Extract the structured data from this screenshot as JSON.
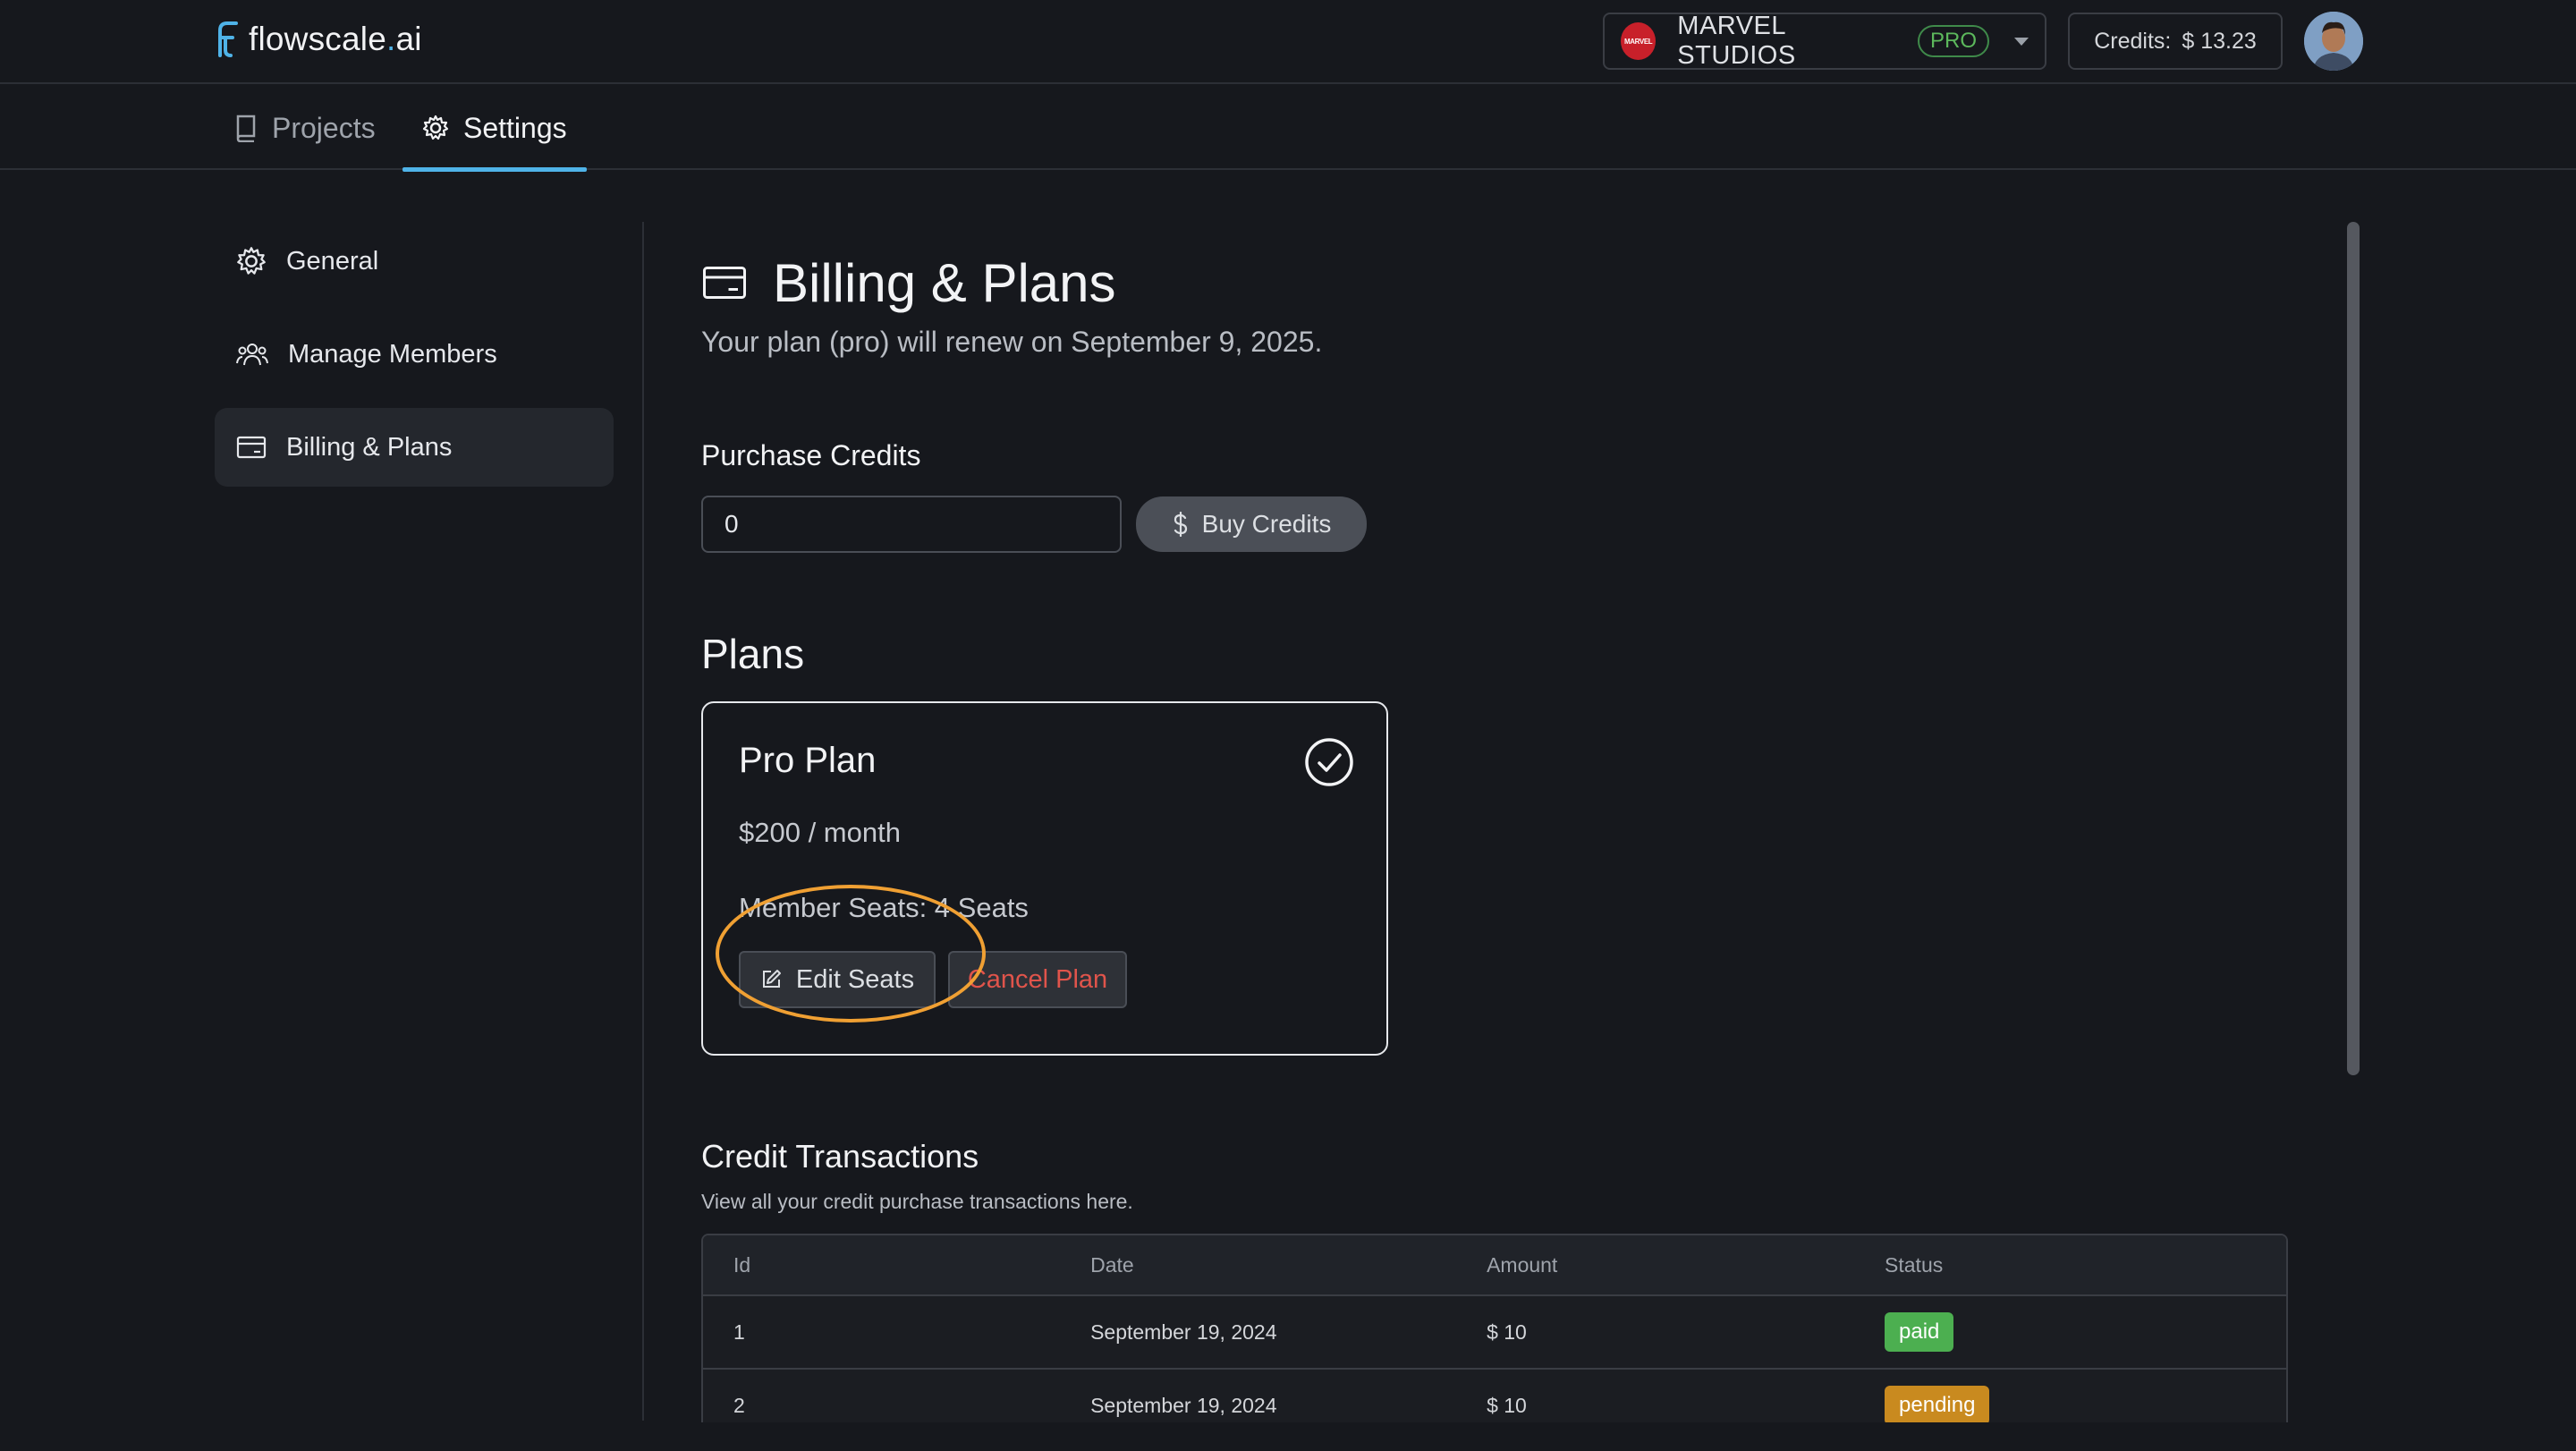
{
  "app": {
    "logo_text": "flowscale",
    "logo_dot": ".",
    "logo_suffix": "ai"
  },
  "header": {
    "org_avatar_text": "MARVEL",
    "org_name": "MARVEL STUDIOS",
    "plan_badge": "PRO",
    "credits_label": "Credits:",
    "credits_value": "$ 13.23"
  },
  "tabs": [
    {
      "label": "Projects",
      "icon": "book-icon"
    },
    {
      "label": "Settings",
      "icon": "gear-icon",
      "active": true
    }
  ],
  "sidebar": {
    "items": [
      {
        "label": "General",
        "icon": "gear-icon"
      },
      {
        "label": "Manage Members",
        "icon": "users-icon"
      },
      {
        "label": "Billing & Plans",
        "icon": "credit-card-icon",
        "active": true
      }
    ]
  },
  "main": {
    "title": "Billing & Plans",
    "subtitle": "Your plan (pro) will renew on September 9, 2025.",
    "purchase": {
      "label": "Purchase Credits",
      "input_value": "0",
      "buy_label": "Buy Credits"
    },
    "plans": {
      "title": "Plans",
      "card": {
        "name": "Pro Plan",
        "price": "$200 / month",
        "seats": "Member Seats: 4 Seats",
        "edit_label": "Edit Seats",
        "cancel_label": "Cancel Plan"
      }
    },
    "transactions": {
      "title": "Credit Transactions",
      "subtitle": "View all your credit purchase transactions here.",
      "columns": [
        "Id",
        "Date",
        "Amount",
        "Status"
      ],
      "rows": [
        {
          "id": "1",
          "date": "September 19, 2024",
          "amount": "$ 10",
          "status": "paid"
        },
        {
          "id": "2",
          "date": "September 19, 2024",
          "amount": "$ 10",
          "status": "pending"
        }
      ]
    }
  },
  "colors": {
    "background": "#16181d",
    "accent": "#4fb3e8",
    "paid": "#4caf50",
    "pending": "#c98a1f",
    "danger": "#e0544b",
    "highlight": "#f0a033"
  }
}
